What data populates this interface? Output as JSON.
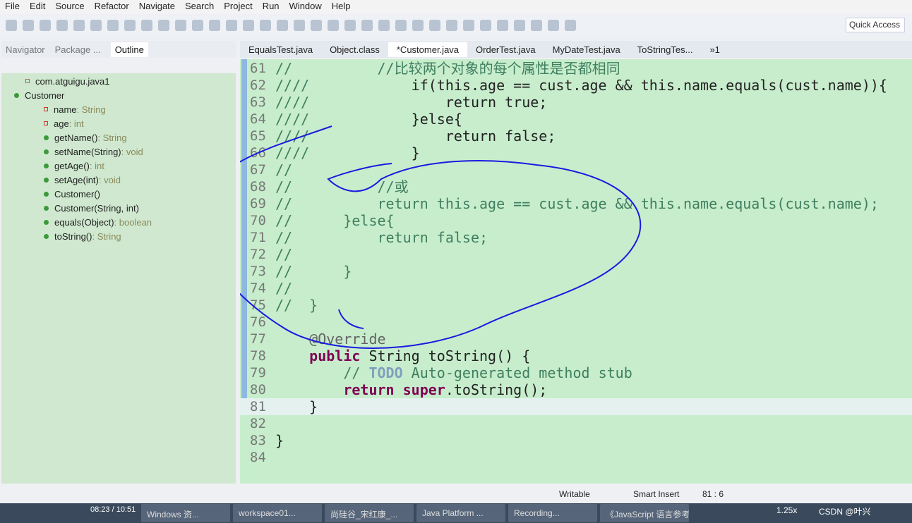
{
  "menu": [
    "File",
    "Edit",
    "Source",
    "Refactor",
    "Navigate",
    "Search",
    "Project",
    "Run",
    "Window",
    "Help"
  ],
  "quick_access": "Quick Access",
  "left_tabs": [
    "Navigator",
    "Package ...",
    "Outline"
  ],
  "outline": [
    {
      "label": "com.atguigu.java1",
      "type": "",
      "kind": "package"
    },
    {
      "label": "Customer",
      "type": "",
      "kind": "class"
    },
    {
      "label": "name",
      "type": " : String",
      "kind": "field"
    },
    {
      "label": "age",
      "type": " : int",
      "kind": "field"
    },
    {
      "label": "getName()",
      "type": " : String",
      "kind": "method"
    },
    {
      "label": "setName(String)",
      "type": " : void",
      "kind": "method"
    },
    {
      "label": "getAge()",
      "type": " : int",
      "kind": "method"
    },
    {
      "label": "setAge(int)",
      "type": " : void",
      "kind": "method"
    },
    {
      "label": "Customer()",
      "type": "",
      "kind": "method"
    },
    {
      "label": "Customer(String, int)",
      "type": "",
      "kind": "method"
    },
    {
      "label": "equals(Object)",
      "type": " : boolean",
      "kind": "method"
    },
    {
      "label": "toString()",
      "type": " : String",
      "kind": "method"
    }
  ],
  "editor_tabs": [
    "EqualsTest.java",
    "Object.class",
    "*Customer.java",
    "OrderTest.java",
    "MyDateTest.java",
    "ToStringTes...",
    "»1"
  ],
  "active_tab": 2,
  "code": [
    {
      "n": "61",
      "parts": [
        [
          "c",
          "//          //比较两个对象的每个属性是否都相同"
        ]
      ]
    },
    {
      "n": "62",
      "parts": [
        [
          "c",
          "////            "
        ],
        [
          "",
          "if(this.age == cust.age && this.name.equals(cust.name)){"
        ]
      ]
    },
    {
      "n": "63",
      "parts": [
        [
          "c",
          "////                "
        ],
        [
          "",
          "return true;"
        ]
      ]
    },
    {
      "n": "64",
      "parts": [
        [
          "c",
          "////            "
        ],
        [
          "",
          "}else{"
        ]
      ]
    },
    {
      "n": "65",
      "parts": [
        [
          "c",
          "////                "
        ],
        [
          "",
          "return false;"
        ]
      ]
    },
    {
      "n": "66",
      "parts": [
        [
          "c",
          "////            "
        ],
        [
          "",
          "}"
        ]
      ]
    },
    {
      "n": "67",
      "parts": [
        [
          "c",
          "//"
        ]
      ]
    },
    {
      "n": "68",
      "parts": [
        [
          "c",
          "//          //或"
        ]
      ]
    },
    {
      "n": "69",
      "parts": [
        [
          "c",
          "//          return this.age == cust.age && this.name.equals(cust.name);"
        ]
      ]
    },
    {
      "n": "70",
      "parts": [
        [
          "c",
          "//      }else{"
        ]
      ]
    },
    {
      "n": "71",
      "parts": [
        [
          "c",
          "//          return false;"
        ]
      ]
    },
    {
      "n": "72",
      "parts": [
        [
          "c",
          "//"
        ]
      ]
    },
    {
      "n": "73",
      "parts": [
        [
          "c",
          "//      }"
        ]
      ]
    },
    {
      "n": "74",
      "parts": [
        [
          "c",
          "//"
        ]
      ]
    },
    {
      "n": "75",
      "parts": [
        [
          "c",
          "//  }"
        ]
      ]
    },
    {
      "n": "76",
      "parts": []
    },
    {
      "n": "77",
      "parts": [
        [
          "a",
          "    @Override"
        ]
      ]
    },
    {
      "n": "78",
      "parts": [
        [
          "k",
          "    public "
        ],
        [
          "",
          "String toString() {"
        ]
      ]
    },
    {
      "n": "79",
      "parts": [
        [
          "c",
          "        // "
        ],
        [
          "t",
          "TODO"
        ],
        [
          "c",
          " Auto-generated method stub"
        ]
      ]
    },
    {
      "n": "80",
      "parts": [
        [
          "k",
          "        return super"
        ],
        [
          "",
          ".toString();"
        ]
      ]
    },
    {
      "n": "81",
      "parts": [
        [
          "",
          "    }"
        ]
      ]
    },
    {
      "n": "82",
      "parts": []
    },
    {
      "n": "83",
      "parts": [
        [
          "",
          "}"
        ]
      ]
    },
    {
      "n": "84",
      "parts": []
    }
  ],
  "current_line": "81",
  "status": {
    "writable": "Writable",
    "insert": "Smart Insert",
    "position": "81 : 6"
  },
  "taskbar": [
    "Windows 资...",
    "workspace01...",
    "尚硅谷_宋红康_...",
    "Java Platform ...",
    "Recording...",
    "《JavaScript 语言参考"
  ],
  "player_time": "08:23 / 10:51",
  "speed": "1.25x",
  "watermark": "CSDN @叶兴",
  "colors": {
    "editor_bg": "#c7edcc",
    "annotation": "#1a1ae0",
    "keyword": "#7f0055",
    "comment": "#3f7f5f"
  }
}
